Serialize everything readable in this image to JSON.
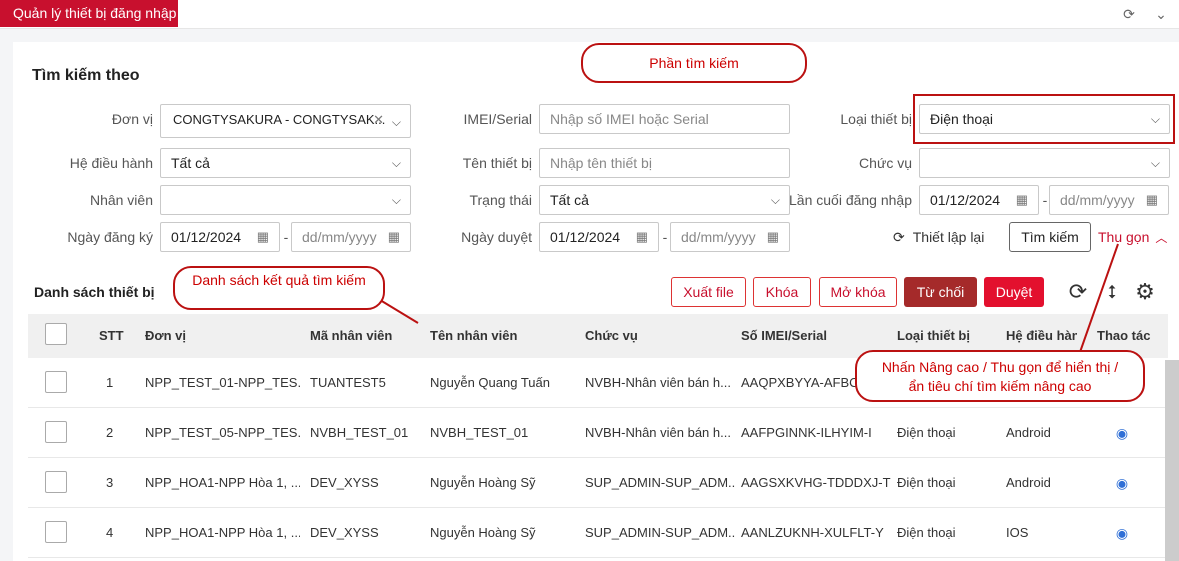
{
  "header": {
    "tab_title": "Quản lý thiết bị đăng nhập"
  },
  "search": {
    "title": "Tìm kiếm theo",
    "don_vi": {
      "label": "Đơn vị",
      "value": "CONGTYSAKURA - CONGTYSAK..."
    },
    "imei": {
      "label": "IMEI/Serial",
      "placeholder": "Nhập số IMEI hoặc Serial"
    },
    "loai_thiet_bi": {
      "label": "Loại thiết bị",
      "value": "Điện thoại"
    },
    "he_dieu_hanh": {
      "label": "Hệ điều hành",
      "value": "Tất cả"
    },
    "ten_thiet_bi": {
      "label": "Tên thiết bị",
      "placeholder": "Nhập tên thiết bị"
    },
    "chuc_vu": {
      "label": "Chức vụ",
      "value": ""
    },
    "nhan_vien": {
      "label": "Nhân viên",
      "value": ""
    },
    "trang_thai": {
      "label": "Trạng thái",
      "value": "Tất cả"
    },
    "lan_cuoi": {
      "label": "Lần cuối đăng nhập",
      "from": "01/12/2024",
      "to": "dd/mm/yyyy"
    },
    "ngay_dang_ky": {
      "label": "Ngày đăng ký",
      "from": "01/12/2024",
      "to": "dd/mm/yyyy"
    },
    "ngay_duyet": {
      "label": "Ngày duyệt",
      "from": "01/12/2024",
      "to": "dd/mm/yyyy"
    },
    "reset_label": "Thiết lập lại",
    "search_label": "Tìm kiếm",
    "collapse_label": "Thu gọn"
  },
  "list": {
    "title": "Danh sách thiết bị",
    "buttons": {
      "export": "Xuất file",
      "lock": "Khóa",
      "unlock": "Mở khóa",
      "reject": "Từ chối",
      "approve": "Duyệt"
    },
    "columns": [
      "STT",
      "Đơn vị",
      "Mã nhân viên",
      "Tên nhân viên",
      "Chức vụ",
      "Số IMEI/Serial",
      "Loại thiết bị",
      "Hệ điều hành",
      "Thao tác"
    ],
    "rows": [
      {
        "stt": "1",
        "don_vi": "NPP_TEST_01-NPP_TES...",
        "ma_nv": "TUANTEST5",
        "ten_nv": "Nguyễn Quang Tuấn",
        "chuc_vu": "NVBH-Nhân viên bán h...",
        "imei": "AAQPXBYYA-AFBCT",
        "loai": "",
        "hdh": ""
      },
      {
        "stt": "2",
        "don_vi": "NPP_TEST_05-NPP_TES...",
        "ma_nv": "NVBH_TEST_01",
        "ten_nv": "NVBH_TEST_01",
        "chuc_vu": "NVBH-Nhân viên bán h...",
        "imei": "AAFPGINNK-ILHYIM-I",
        "loai": "Điện thoại",
        "hdh": "Android"
      },
      {
        "stt": "3",
        "don_vi": "NPP_HOA1-NPP Hòa 1, ...",
        "ma_nv": "DEV_XYSS",
        "ten_nv": "Nguyễn Hoàng Sỹ",
        "chuc_vu": "SUP_ADMIN-SUP_ADM...",
        "imei": "AAGSXKVHG-TDDDXJ-T",
        "loai": "Điện thoại",
        "hdh": "Android"
      },
      {
        "stt": "4",
        "don_vi": "NPP_HOA1-NPP Hòa 1, ...",
        "ma_nv": "DEV_XYSS",
        "ten_nv": "Nguyễn Hoàng Sỹ",
        "chuc_vu": "SUP_ADMIN-SUP_ADM...",
        "imei": "AANLZUKNH-XULFLT-Y",
        "loai": "Điện thoại",
        "hdh": "IOS"
      }
    ]
  },
  "callouts": {
    "search": "Phần tìm kiếm",
    "results": "Danh sách kết quả tìm kiếm",
    "toggle": "Nhấn Nâng cao / Thu gọn để hiển thị / ẩn tiêu chí tìm kiếm nâng cao"
  },
  "colors": {
    "brand": "#c8102e",
    "reject": "#a52a2a",
    "approve": "#e3102e",
    "link": "#2f6fd6"
  }
}
